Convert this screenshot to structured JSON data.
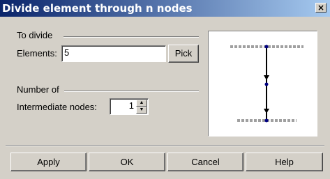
{
  "window": {
    "title": "Divide element through n nodes",
    "close_symbol": "×"
  },
  "to_divide": {
    "group_label": "To divide",
    "elements_label": "Elements:",
    "elements_value": "5",
    "pick_label": "Pick"
  },
  "number_of": {
    "group_label": "Number of",
    "intermediate_label": "Intermediate nodes:",
    "intermediate_value": "1"
  },
  "preview": {
    "icon": "divided-beam-preview"
  },
  "buttons": {
    "apply": "Apply",
    "ok": "OK",
    "cancel": "Cancel",
    "help": "Help"
  }
}
